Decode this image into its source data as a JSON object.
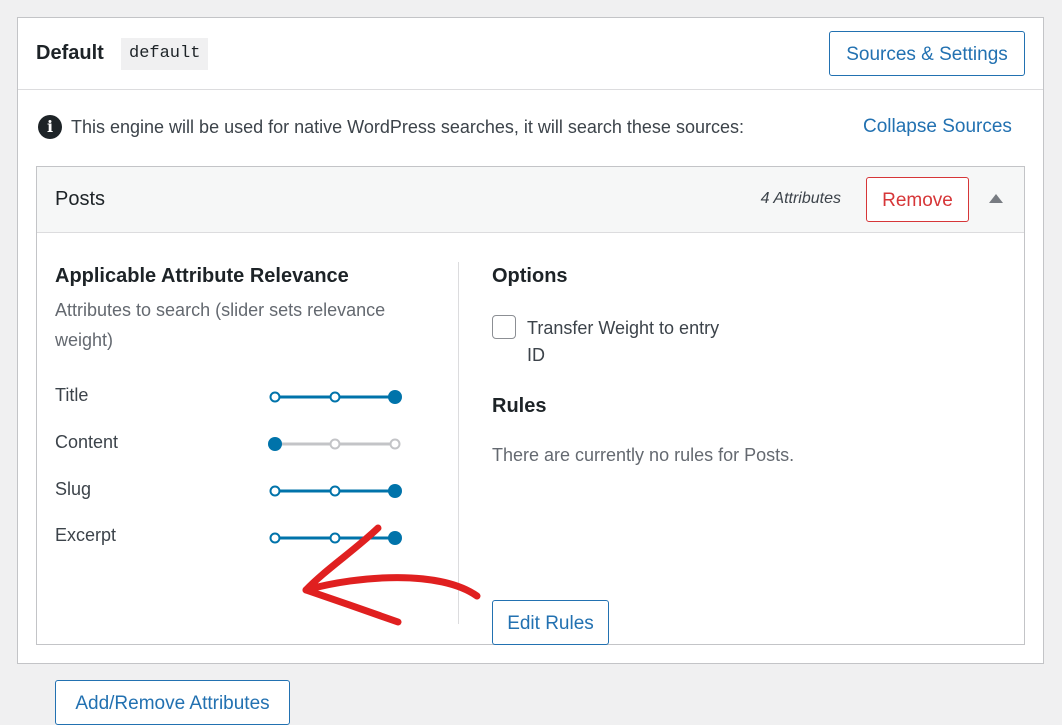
{
  "engine": {
    "title": "Default",
    "slug": "default",
    "sources_settings_label": "Sources & Settings",
    "notice": "This engine will be used for native WordPress searches, it will search these sources:",
    "collapse_label": "Collapse Sources"
  },
  "source": {
    "title": "Posts",
    "attribute_count": "4 Attributes",
    "remove_label": "Remove",
    "relevance": {
      "heading": "Applicable Attribute Relevance",
      "description": "Attributes to search (slider sets relevance weight)",
      "attributes": [
        {
          "label": "Title",
          "level": 3,
          "max": 3
        },
        {
          "label": "Content",
          "level": 1,
          "max": 3
        },
        {
          "label": "Slug",
          "level": 3,
          "max": 3
        },
        {
          "label": "Excerpt",
          "level": 3,
          "max": 3
        }
      ],
      "add_remove_label": "Add/Remove Attributes"
    },
    "options": {
      "heading": "Options",
      "transfer_weight_label": "Transfer Weight to entry ID",
      "transfer_weight_checked": false
    },
    "rules": {
      "heading": "Rules",
      "empty_text": "There are currently no rules for Posts.",
      "edit_label": "Edit Rules"
    }
  },
  "colors": {
    "accent": "#2271b1",
    "slider_active": "#0073aa",
    "slider_inactive": "#c3c4c7",
    "danger": "#d63638",
    "annotation": "#e02020"
  },
  "icons": {
    "notice_icon": "info-icon",
    "collapse_icon": "triangle-up-icon",
    "annotation": "red-arrow-annotation"
  }
}
